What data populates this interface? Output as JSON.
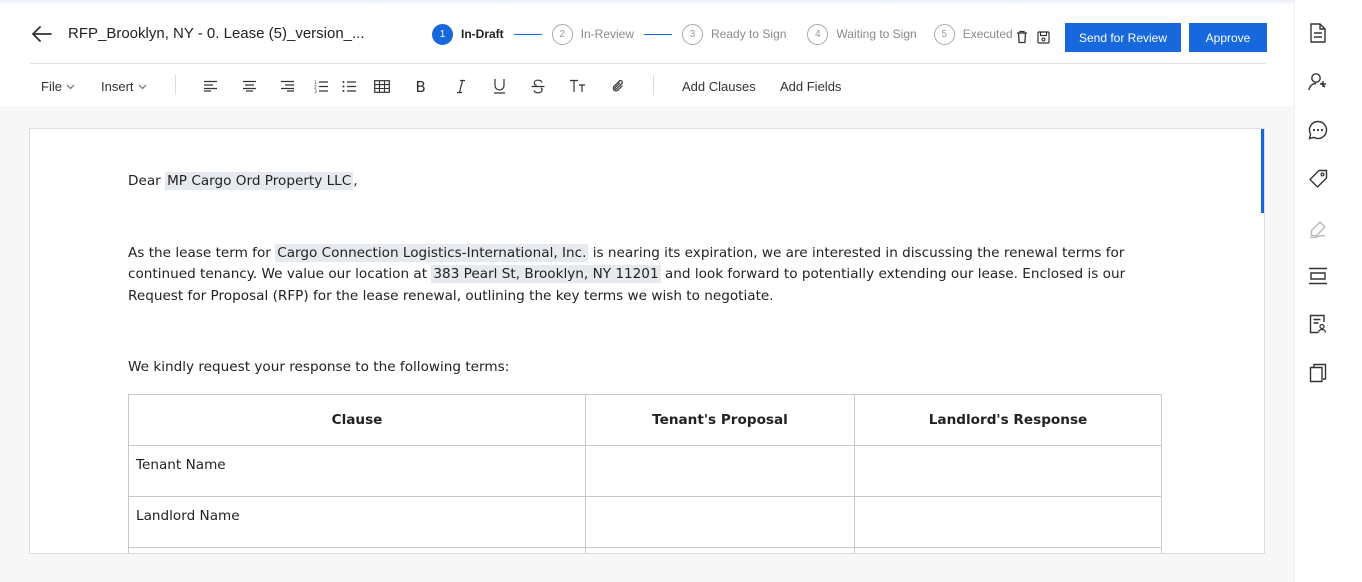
{
  "header": {
    "title": "RFP_Brooklyn, NY - 0. Lease (5)_version_...",
    "steps": [
      {
        "num": "1",
        "label": "In-Draft"
      },
      {
        "num": "2",
        "label": "In-Review"
      },
      {
        "num": "3",
        "label": "Ready to Sign"
      },
      {
        "num": "4",
        "label": "Waiting to Sign"
      },
      {
        "num": "5",
        "label": "Executed"
      }
    ],
    "send_for_review_label": "Send for Review",
    "approve_label": "Approve"
  },
  "toolbar": {
    "file_label": "File",
    "insert_label": "Insert",
    "add_clauses_label": "Add Clauses",
    "add_fields_label": "Add Fields"
  },
  "document": {
    "greeting_prefix": "Dear ",
    "landlord_field": "MP Cargo Ord Property LLC",
    "greeting_suffix": ",",
    "p1_a": "As the lease term for ",
    "tenant_field": "Cargo Connection Logistics-International, Inc.",
    "p1_b": " is nearing its expiration, we are interested in discussing the renewal terms for continued tenancy. We value our location at ",
    "address_field": "383 Pearl St, Brooklyn, NY 11201",
    "p1_c": " and look forward to potentially extending our lease. Enclosed is our Request for Proposal (RFP) for the lease renewal, outlining the key terms we wish to negotiate.",
    "p2": "We kindly request your response to the following terms:",
    "table": {
      "headers": [
        "Clause",
        "Tenant's Proposal",
        "Landlord's Response"
      ],
      "rows": [
        [
          "Tenant Name",
          "",
          ""
        ],
        [
          "Landlord Name",
          "",
          ""
        ],
        [
          "",
          "",
          ""
        ]
      ]
    }
  },
  "colors": {
    "primary": "#1668dc",
    "field_highlight": "#e6e9ee"
  },
  "icons": {
    "right_rail": [
      "document-icon",
      "user-search-icon",
      "comment-icon",
      "tag-icon",
      "signature-icon",
      "layout-icon",
      "document-user-icon",
      "copy-icon"
    ]
  }
}
